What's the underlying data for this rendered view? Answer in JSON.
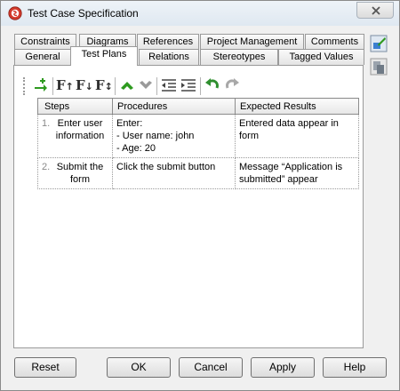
{
  "window": {
    "title": "Test Case Specification"
  },
  "tabs": {
    "row_top": [
      "Constraints",
      "Diagrams",
      "References",
      "Project Management",
      "Comments"
    ],
    "row_bottom": [
      "General",
      "Test Plans",
      "Relations",
      "Stereotypes",
      "Tagged Values"
    ],
    "active": "Test Plans"
  },
  "toolbar": {
    "icons": [
      "add-row-icon",
      "font-up-icon",
      "font-down-icon",
      "font-updown-icon",
      "move-up-icon",
      "move-down-icon",
      "outdent-icon",
      "indent-icon",
      "undo-icon",
      "redo-icon"
    ]
  },
  "table": {
    "headers": [
      "Steps",
      "Procedures",
      "Expected Results"
    ],
    "rows": [
      {
        "num": "1.",
        "step": "Enter user information",
        "procedure_lines": [
          "Enter:",
          "- User name: john",
          "- Age: 20"
        ],
        "expected": "Entered data appear in form"
      },
      {
        "num": "2.",
        "step": "Submit the form",
        "procedure_lines": [
          "Click the submit button"
        ],
        "expected": "Message “Application is submitted” appear"
      }
    ]
  },
  "buttons": {
    "reset": "Reset",
    "ok": "OK",
    "cancel": "Cancel",
    "apply": "Apply",
    "help": "Help"
  },
  "colors": {
    "accent_green": "#2e9a1f",
    "undo_green": "#2f8f2f",
    "arrow_gray": "#9a9a9a"
  }
}
